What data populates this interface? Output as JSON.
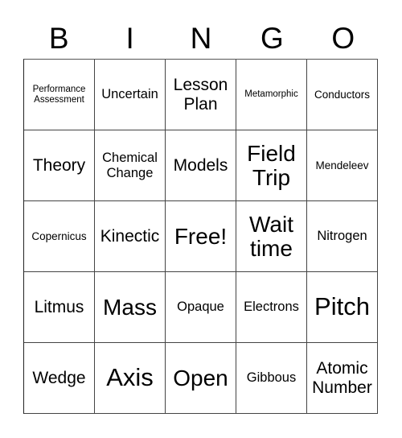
{
  "header": {
    "letters": [
      "B",
      "I",
      "N",
      "G",
      "O"
    ]
  },
  "board": {
    "rows": [
      [
        {
          "text": "Performance Assessment",
          "size": "s-xs"
        },
        {
          "text": "Uncertain",
          "size": "s-md"
        },
        {
          "text": "Lesson Plan",
          "size": "s-lg"
        },
        {
          "text": "Metamorphic",
          "size": "s-xs"
        },
        {
          "text": "Conductors",
          "size": "s-sm"
        }
      ],
      [
        {
          "text": "Theory",
          "size": "s-lg"
        },
        {
          "text": "Chemical Change",
          "size": "s-md"
        },
        {
          "text": "Models",
          "size": "s-lg"
        },
        {
          "text": "Field Trip",
          "size": "s-xxl"
        },
        {
          "text": "Mendeleev",
          "size": "s-sm"
        }
      ],
      [
        {
          "text": "Copernicus",
          "size": "s-sm"
        },
        {
          "text": "Kinectic",
          "size": "s-lg"
        },
        {
          "text": "Free!",
          "size": "s-xxl"
        },
        {
          "text": "Wait time",
          "size": "s-xxl"
        },
        {
          "text": "Nitrogen",
          "size": "s-md"
        }
      ],
      [
        {
          "text": "Litmus",
          "size": "s-lg"
        },
        {
          "text": "Mass",
          "size": "s-xxl"
        },
        {
          "text": "Opaque",
          "size": "s-md"
        },
        {
          "text": "Electrons",
          "size": "s-md"
        },
        {
          "text": "Pitch",
          "size": "s-xxxl"
        }
      ],
      [
        {
          "text": "Wedge",
          "size": "s-lg"
        },
        {
          "text": "Axis",
          "size": "s-xxxl"
        },
        {
          "text": "Open",
          "size": "s-xxl"
        },
        {
          "text": "Gibbous",
          "size": "s-md"
        },
        {
          "text": "Atomic Number",
          "size": "s-lg"
        }
      ]
    ]
  }
}
